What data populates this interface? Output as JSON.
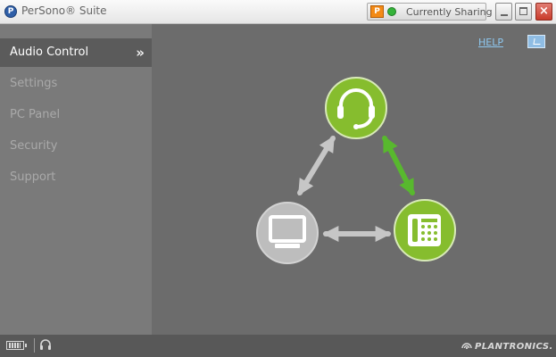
{
  "window": {
    "title": "PerSono® Suite",
    "app_icon_letter": "P",
    "sharing_status": "Currently Sharing",
    "close_glyph": "×"
  },
  "sidebar": {
    "items": [
      {
        "label": "Audio Control",
        "active": true
      },
      {
        "label": "Settings",
        "active": false
      },
      {
        "label": "PC Panel",
        "active": false
      },
      {
        "label": "Security",
        "active": false
      },
      {
        "label": "Support",
        "active": false
      }
    ],
    "active_chevron": "»"
  },
  "main": {
    "help_label": "HELP",
    "diagram": {
      "devices": [
        {
          "name": "headset",
          "status": "active",
          "color": "#86bd2e"
        },
        {
          "name": "desk-phone",
          "status": "active",
          "color": "#86bd2e"
        },
        {
          "name": "computer",
          "status": "inactive",
          "color": "#bdbdbd"
        }
      ],
      "links": [
        {
          "from": "headset",
          "to": "desk-phone",
          "status": "active",
          "color": "#58b82e"
        },
        {
          "from": "headset",
          "to": "computer",
          "status": "inactive",
          "color": "#c6c6c6"
        },
        {
          "from": "computer",
          "to": "desk-phone",
          "status": "inactive",
          "color": "#c6c6c6"
        }
      ]
    }
  },
  "footer": {
    "brand": "PLANTRONICS."
  },
  "colors": {
    "sidebar_active": "#5b5b5b",
    "content_background": "#6c6c6c",
    "accent_green": "#86bd2e",
    "help_link": "#8ec8f0"
  },
  "icons": [
    "app-icon",
    "share-icon",
    "status-dot",
    "minimize-icon",
    "maximize-icon",
    "close-icon",
    "headset-icon",
    "desk-phone-icon",
    "computer-icon",
    "battery-icon",
    "small-headset-icon",
    "plantronics-logo-icon"
  ]
}
